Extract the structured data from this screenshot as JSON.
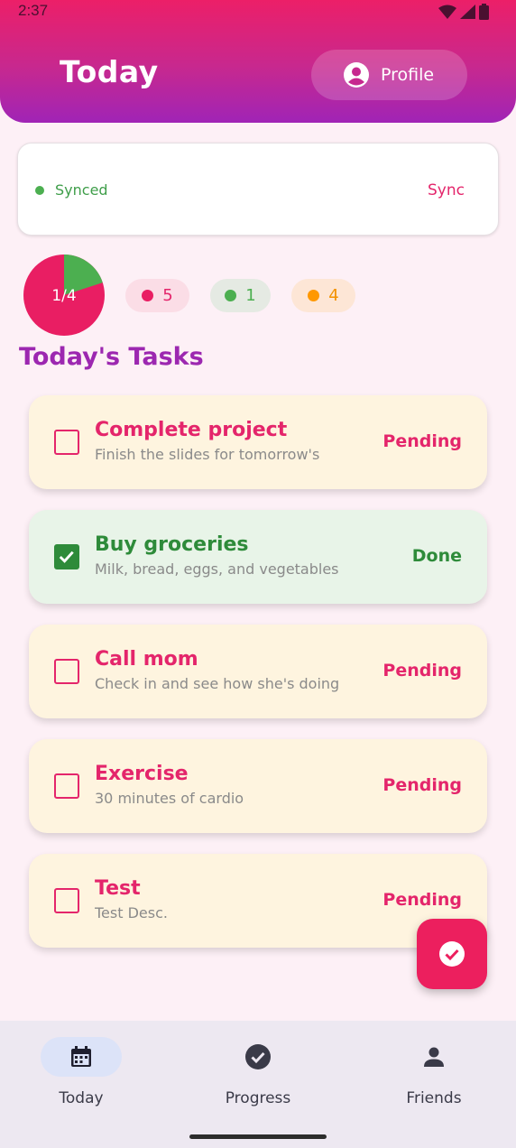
{
  "status_bar": {
    "time": "2:37"
  },
  "header": {
    "title": "Today",
    "profile_label": "Profile"
  },
  "sync": {
    "status": "Synced",
    "action": "Sync"
  },
  "stats": {
    "progress_label": "1/4",
    "progress_fraction": 0.2,
    "pending_count": "5",
    "done_count": "1",
    "other_count": "4"
  },
  "section_title": "Today's Tasks",
  "tasks": [
    {
      "title": "Complete project",
      "desc": "Finish the slides for tomorrow's",
      "status": "Pending",
      "done": false
    },
    {
      "title": "Buy groceries",
      "desc": "Milk, bread, eggs, and vegetables",
      "status": "Done",
      "done": true
    },
    {
      "title": "Call mom",
      "desc": "Check in and see how she's doing",
      "status": "Pending",
      "done": false
    },
    {
      "title": "Exercise",
      "desc": "30 minutes of cardio",
      "status": "Pending",
      "done": false
    },
    {
      "title": "Test",
      "desc": "Test Desc.",
      "status": "Pending",
      "done": false
    }
  ],
  "fab_icon": "check-circle-icon",
  "nav": {
    "today": "Today",
    "progress": "Progress",
    "friends": "Friends"
  },
  "colors": {
    "accent": "#e4256b",
    "done_green": "#2e8b3a",
    "purple": "#9c27b0",
    "orange": "#ff9800"
  }
}
